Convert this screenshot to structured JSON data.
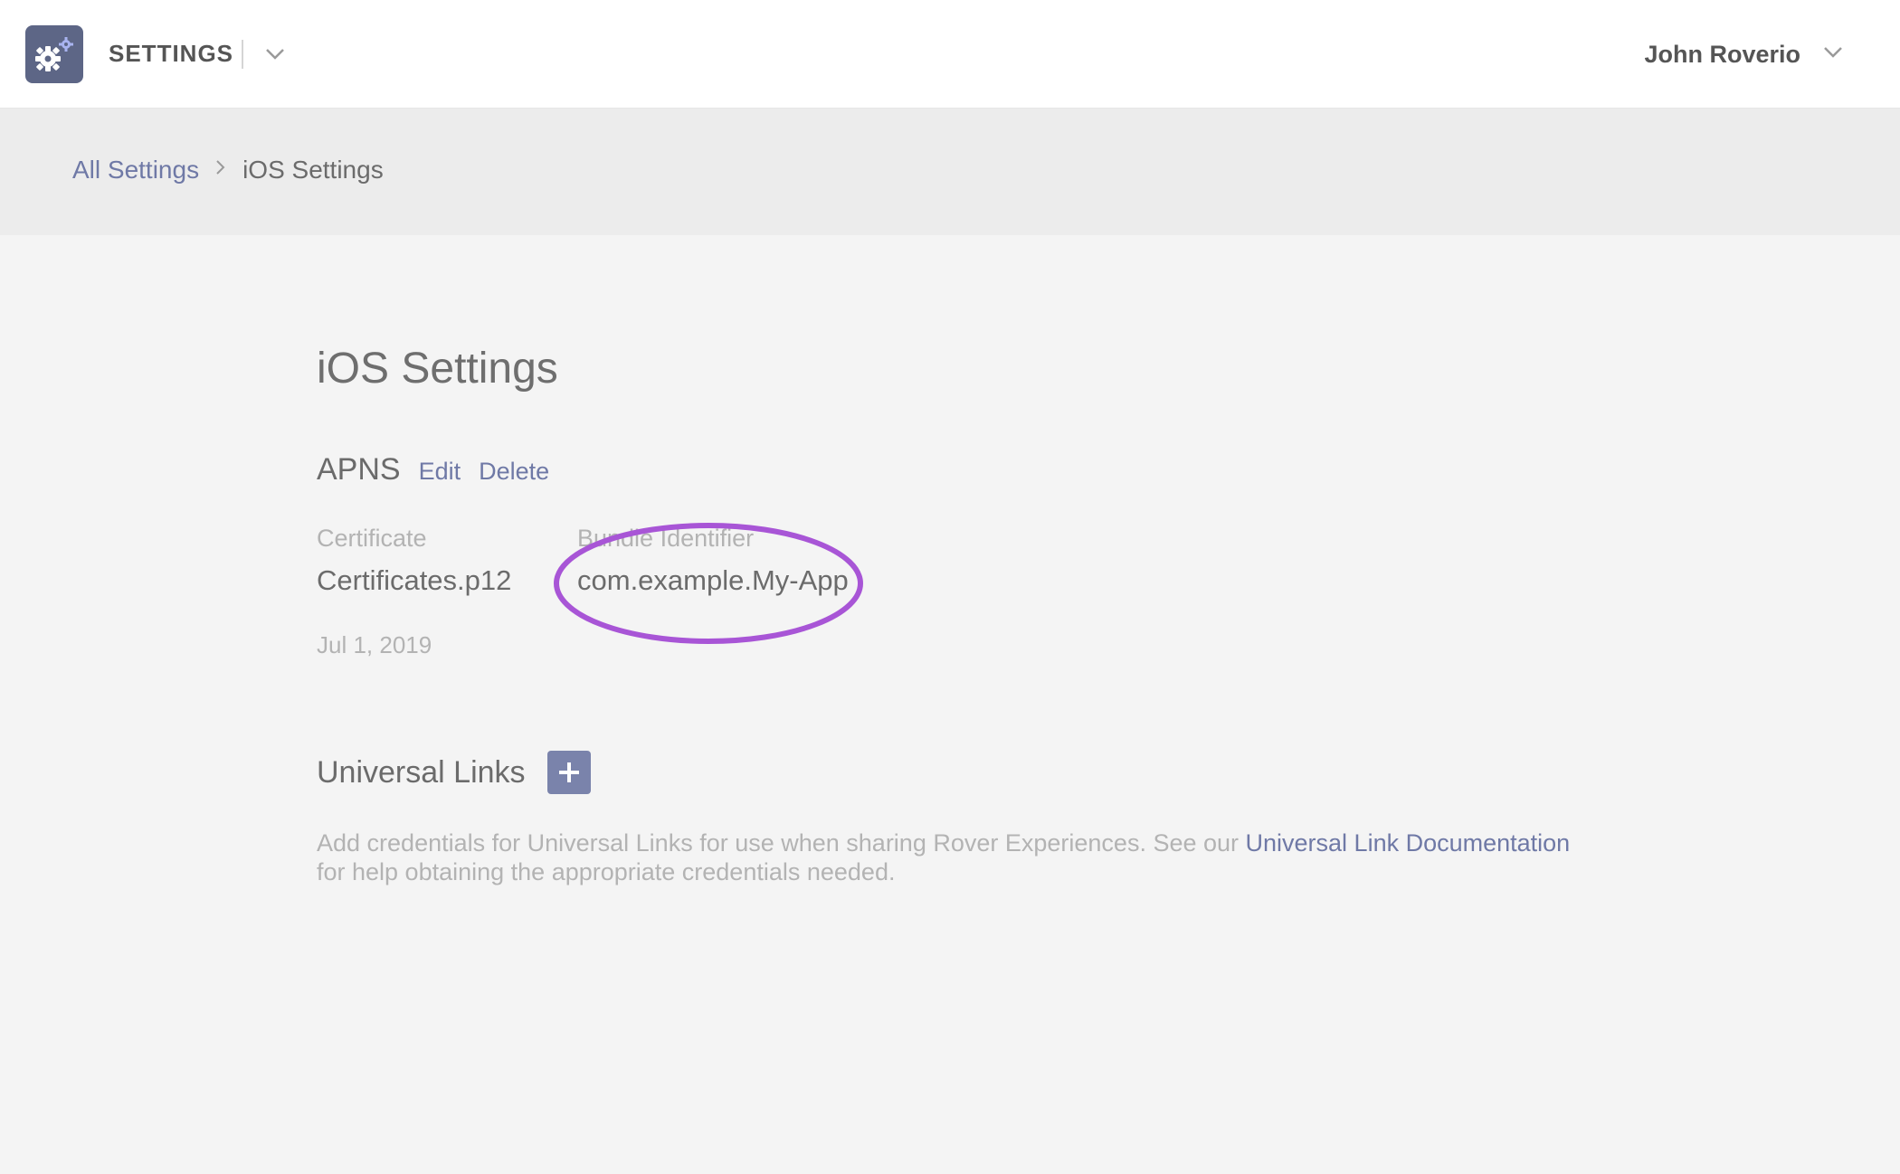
{
  "header": {
    "app_title": "SETTINGS",
    "app_icon": "gears-icon",
    "user_name": "John Roverio"
  },
  "breadcrumb": {
    "root": "All Settings",
    "current": "iOS Settings"
  },
  "page": {
    "title": "iOS Settings",
    "apns": {
      "title": "APNS",
      "edit_label": "Edit",
      "delete_label": "Delete",
      "certificate_label": "Certificate",
      "certificate_value": "Certificates.p12",
      "bundle_label": "Bundle Identifier",
      "bundle_value": "com.example.My-App",
      "date": "Jul 1, 2019"
    },
    "universal_links": {
      "title": "Universal Links",
      "description_before": "Add credentials for Universal Links for use when sharing Rover Experiences. See our ",
      "doc_link": "Universal Link Documentation",
      "description_after": " for help obtaining the appropriate credentials needed."
    }
  },
  "colors": {
    "accent": "#6f79a6",
    "icon_bg": "#5d6686",
    "add_button": "#7a83ab",
    "highlight": "#a855d6",
    "page_bg": "#f4f4f4",
    "band_bg": "#ececec"
  }
}
